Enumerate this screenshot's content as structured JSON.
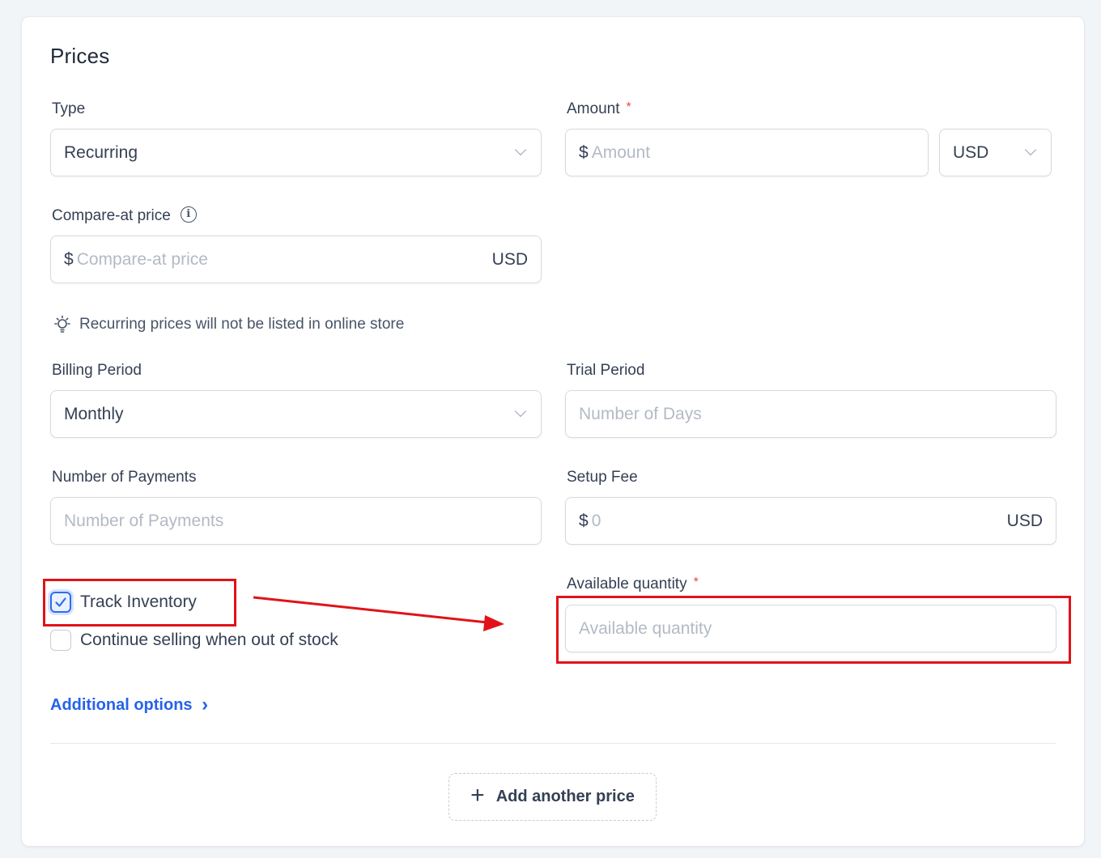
{
  "section_title": "Prices",
  "type_field": {
    "label": "Type",
    "value": "Recurring"
  },
  "amount_field": {
    "label": "Amount",
    "required_mark": "*",
    "currency_symbol": "$",
    "placeholder": "Amount",
    "currency": "USD"
  },
  "compare_at_field": {
    "label": "Compare-at price",
    "info_glyph": "i",
    "currency_symbol": "$",
    "placeholder": "Compare-at price",
    "suffix": "USD"
  },
  "hint": {
    "icon": "lightbulb-icon",
    "text": "Recurring prices will not be listed in online store"
  },
  "billing_period_field": {
    "label": "Billing Period",
    "value": "Monthly"
  },
  "trial_period_field": {
    "label": "Trial Period",
    "placeholder": "Number of Days"
  },
  "payments_field": {
    "label": "Number of Payments",
    "placeholder": "Number of Payments"
  },
  "setup_fee_field": {
    "label": "Setup Fee",
    "currency_symbol": "$",
    "placeholder": "0",
    "suffix": "USD"
  },
  "track_inventory": {
    "label": "Track Inventory",
    "checked": true
  },
  "continue_selling": {
    "label": "Continue selling when out of stock",
    "checked": false
  },
  "available_quantity_field": {
    "label": "Available quantity",
    "required_mark": "*",
    "placeholder": "Available quantity"
  },
  "additional_options": {
    "label": "Additional options",
    "chevron": "›"
  },
  "add_price_button": {
    "icon": "+",
    "label": "Add another price"
  },
  "colors": {
    "accent": "#2563eb",
    "annotation_red": "#e0131a",
    "required": "#e5484d"
  }
}
